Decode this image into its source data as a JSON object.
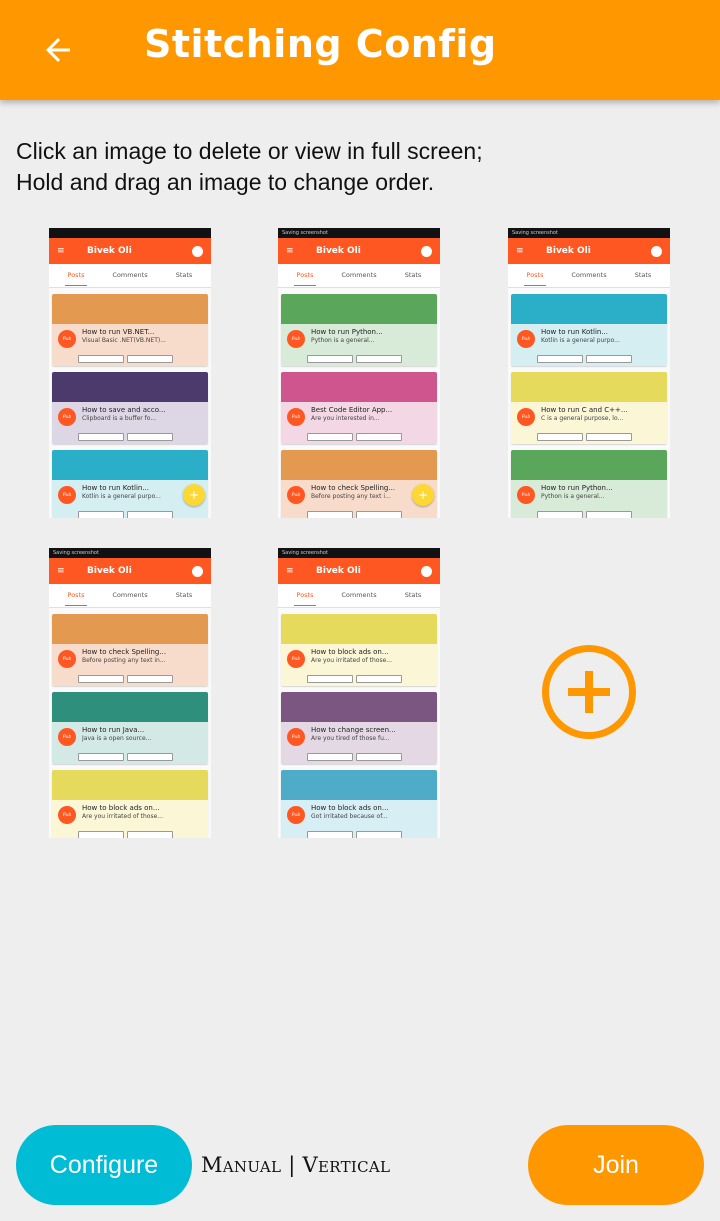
{
  "appbar": {
    "title": "Stitching Config",
    "back_icon": "arrow-back-icon",
    "color": "#ff9800"
  },
  "instructions": {
    "line1": "Click an image to delete or view in full screen;",
    "line2": "Hold and drag an image to change order."
  },
  "thumbnails": [
    {
      "status": "",
      "app_title": "Bivek Oli",
      "tabs": [
        "Posts",
        "Comments",
        "Stats"
      ],
      "has_fab": true,
      "cards": [
        {
          "color": "#e3994f",
          "bg": "#f8dccb",
          "title": "How to run VB.NET...",
          "sub": "Visual Basic .NET(VB.NET)..."
        },
        {
          "color": "#4b3a6b",
          "bg": "#ddd6e5",
          "title": "How to save and acco...",
          "sub": "Clipboard is a buffer fo..."
        },
        {
          "color": "#2bafc9",
          "bg": "#d5eef2",
          "title": "How to run Kotlin...",
          "sub": "Kotlin is a general purpo..."
        },
        {
          "color": "#e6da5c",
          "bg": "#faf6d6",
          "title": "",
          "sub": ""
        }
      ]
    },
    {
      "status": "Saving screenshot",
      "app_title": "Bivek Oli",
      "tabs": [
        "Posts",
        "Comments",
        "Stats"
      ],
      "has_fab": true,
      "cards": [
        {
          "color": "#5aa65a",
          "bg": "#d8ead8",
          "title": "How to run Python...",
          "sub": "Python is a general..."
        },
        {
          "color": "#cf558e",
          "bg": "#f3d7e4",
          "title": "Best Code Editor App...",
          "sub": "Are you interested in..."
        },
        {
          "color": "#e3994f",
          "bg": "#f8dccb",
          "title": "How to check Spelling...",
          "sub": "Before posting any text i..."
        }
      ]
    },
    {
      "status": "Saving screenshot",
      "app_title": "Bivek Oli",
      "tabs": [
        "Posts",
        "Comments",
        "Stats"
      ],
      "has_fab": false,
      "cards": [
        {
          "color": "#2bafc9",
          "bg": "#d5eef2",
          "title": "How to run Kotlin...",
          "sub": "Kotlin is a general purpo..."
        },
        {
          "color": "#e6da5c",
          "bg": "#faf6d6",
          "title": "How to run C and C++...",
          "sub": "C is a general purpose, lo..."
        },
        {
          "color": "#5aa65a",
          "bg": "#d8ead8",
          "title": "How to run Python...",
          "sub": "Python is a general..."
        }
      ]
    },
    {
      "status": "Saving screenshot",
      "app_title": "Bivek Oli",
      "tabs": [
        "Posts",
        "Comments",
        "Stats"
      ],
      "has_fab": false,
      "cards": [
        {
          "color": "#e3994f",
          "bg": "#f8dccb",
          "title": "How to check Spelling...",
          "sub": "Before posting any text in..."
        },
        {
          "color": "#2e8f7d",
          "bg": "#d3e9e5",
          "title": "How to run Java...",
          "sub": "Java is a open source..."
        },
        {
          "color": "#e6da5c",
          "bg": "#faf6d6",
          "title": "How to block ads on...",
          "sub": "Are you irritated of those..."
        }
      ]
    },
    {
      "status": "Saving screenshot",
      "app_title": "Bivek Oli",
      "tabs": [
        "Posts",
        "Comments",
        "Stats"
      ],
      "has_fab": false,
      "cards": [
        {
          "color": "#e6da5c",
          "bg": "#faf6d6",
          "title": "How to block ads on...",
          "sub": "Are you irritated of those..."
        },
        {
          "color": "#7b5680",
          "bg": "#e3d8e4",
          "title": "How to change screen...",
          "sub": "Are you tired of those fu..."
        },
        {
          "color": "#4facc8",
          "bg": "#d7eef4",
          "title": "How to block ads on...",
          "sub": "Got irritated because of..."
        }
      ]
    }
  ],
  "add_button_icon": "add-circle-icon",
  "bottom": {
    "configure_label": "Configure",
    "mode_label": "Manual | Vertical",
    "join_label": "Join"
  }
}
